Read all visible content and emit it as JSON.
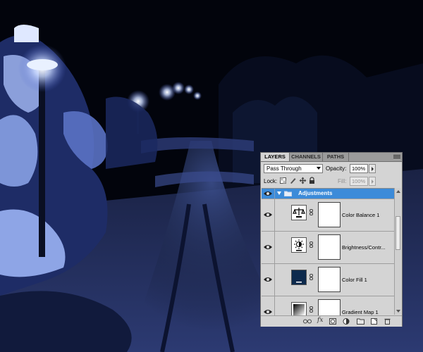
{
  "scene": {
    "description_icon": "snowy-night-path-photo",
    "colors": {
      "sky": "#02040c",
      "snow": "#8ea5e6",
      "lamp": "#eef4ff"
    }
  },
  "panel": {
    "tabs": [
      {
        "label": "LAYERS",
        "active": true
      },
      {
        "label": "CHANNELS",
        "active": false
      },
      {
        "label": "PATHS",
        "active": false
      }
    ],
    "menu_icon": "panel-menu-icon",
    "blend_mode": "Pass Through",
    "opacity_label": "Opacity:",
    "opacity_value": "100%",
    "lock_label": "Lock:",
    "lock_icons": [
      "lock-transparency-icon",
      "lock-image-icon",
      "lock-position-icon",
      "lock-all-icon"
    ],
    "fill_label": "Fill:",
    "fill_value": "100%",
    "group": {
      "name": "Adjustments",
      "icon": "folder-icon",
      "expanded": true
    },
    "layers": [
      {
        "name": "Color Balance 1",
        "icon": "color-balance-icon",
        "visible": true
      },
      {
        "name": "Brightness/Contr...",
        "icon": "brightness-contrast-icon",
        "visible": true
      },
      {
        "name": "Color Fill 1",
        "icon": "color-fill-swatch-icon",
        "visible": true,
        "swatch": "#0d2a4d"
      },
      {
        "name": "Gradient Map 1",
        "icon": "gradient-map-icon",
        "visible": true
      }
    ],
    "bottom_icons": [
      "link-layers-icon",
      "fx-icon",
      "add-mask-icon",
      "new-adjustment-icon",
      "new-group-icon",
      "new-layer-icon",
      "delete-layer-icon"
    ],
    "fx_text": "fx",
    "accent": "#3c8bd9"
  }
}
